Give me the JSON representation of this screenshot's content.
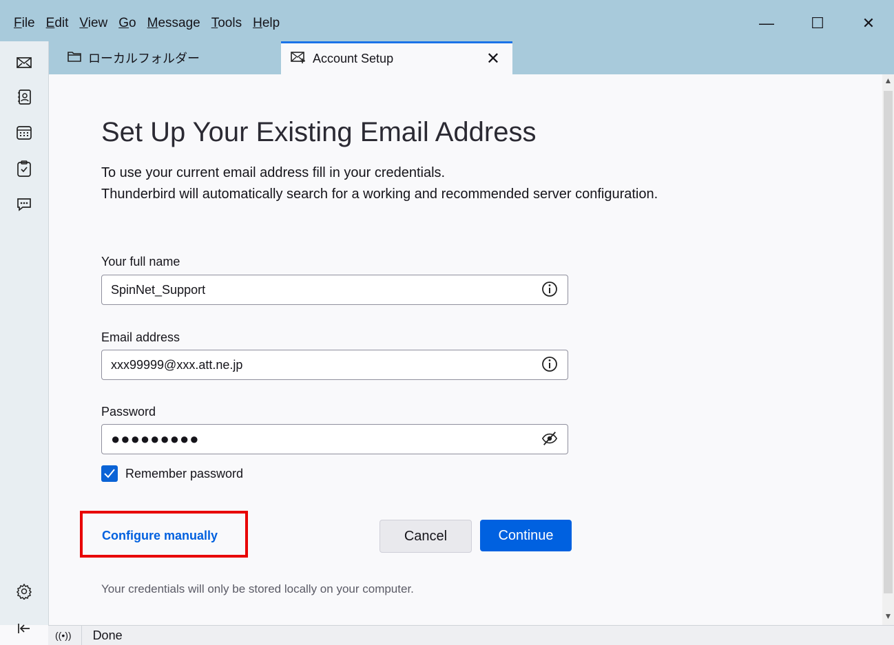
{
  "menubar": {
    "items": [
      {
        "key": "F",
        "rest": "ile"
      },
      {
        "key": "E",
        "rest": "dit"
      },
      {
        "key": "V",
        "rest": "iew"
      },
      {
        "key": "G",
        "rest": "o"
      },
      {
        "key": "M",
        "rest": "essage"
      },
      {
        "key": "T",
        "rest": "ools"
      },
      {
        "key": "H",
        "rest": "elp"
      }
    ]
  },
  "window_controls": {
    "minimize": "—",
    "maximize": "☐",
    "close": "✕"
  },
  "tabs": {
    "folder_label": "ローカルフォルダー",
    "account_label": "Account Setup",
    "close_glyph": "✕"
  },
  "spaces": [
    "mail-icon",
    "address-book-icon",
    "calendar-icon",
    "tasks-icon",
    "chat-icon",
    "settings-icon",
    "collapse-icon"
  ],
  "page": {
    "title": "Set Up Your Existing Email Address",
    "intro_line1": "To use your current email address fill in your credentials.",
    "intro_line2": "Thunderbird will automatically search for a working and recommended server configuration."
  },
  "form": {
    "name_label": "Your full name",
    "name_value": "SpinNet_Support",
    "email_label": "Email address",
    "email_value": "xxx99999@xxx.att.ne.jp",
    "password_label": "Password",
    "password_value": "●●●●●●●●●",
    "remember_label": "Remember password",
    "remember_checked": true
  },
  "actions": {
    "configure_manually": "Configure manually",
    "cancel": "Cancel",
    "continue": "Continue"
  },
  "footnote": "Your credentials will only be stored locally on your computer.",
  "status": {
    "text": "Done"
  },
  "colors": {
    "accent": "#0061e0",
    "highlight": "#e80000",
    "titlebar": "#a8cadb"
  }
}
